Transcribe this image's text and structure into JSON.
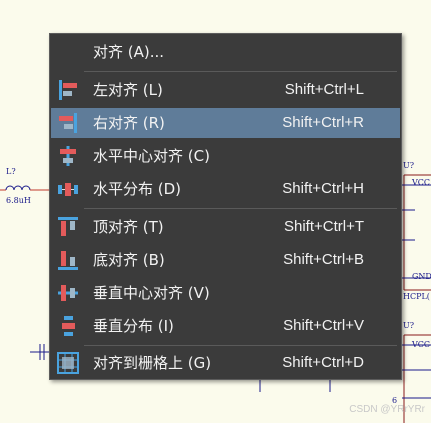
{
  "menu": {
    "items": [
      {
        "label": "对齐 (A)...",
        "shortcut": "",
        "icon": "none"
      },
      {
        "label": "左对齐 (L)",
        "shortcut": "Shift+Ctrl+L",
        "icon": "align-left-icon"
      },
      {
        "label": "右对齐 (R)",
        "shortcut": "Shift+Ctrl+R",
        "icon": "align-right-icon",
        "highlighted": true
      },
      {
        "label": "水平中心对齐 (C)",
        "shortcut": "",
        "icon": "align-horizontal-center-icon"
      },
      {
        "label": "水平分布 (D)",
        "shortcut": "Shift+Ctrl+H",
        "icon": "distribute-horizontal-icon"
      },
      {
        "label": "顶对齐 (T)",
        "shortcut": "Shift+Ctrl+T",
        "icon": "align-top-icon"
      },
      {
        "label": "底对齐 (B)",
        "shortcut": "Shift+Ctrl+B",
        "icon": "align-bottom-icon"
      },
      {
        "label": "垂直中心对齐 (V)",
        "shortcut": "",
        "icon": "align-vertical-center-icon"
      },
      {
        "label": "垂直分布 (I)",
        "shortcut": "Shift+Ctrl+V",
        "icon": "distribute-vertical-icon"
      },
      {
        "label": "对齐到栅格上 (G)",
        "shortcut": "Shift+Ctrl+D",
        "icon": "align-to-grid-icon"
      }
    ]
  },
  "schematic": {
    "labels": [
      "L?",
      "6.8uH",
      "U?",
      "VCC",
      "GND",
      "HCPL(",
      "U?",
      "VCC",
      "6"
    ]
  },
  "watermark": "CSDN @YRrYRr",
  "colors": {
    "menu_bg": "#3b3b3b",
    "highlight": "#5f7c99",
    "canvas": "#fbfbec"
  }
}
